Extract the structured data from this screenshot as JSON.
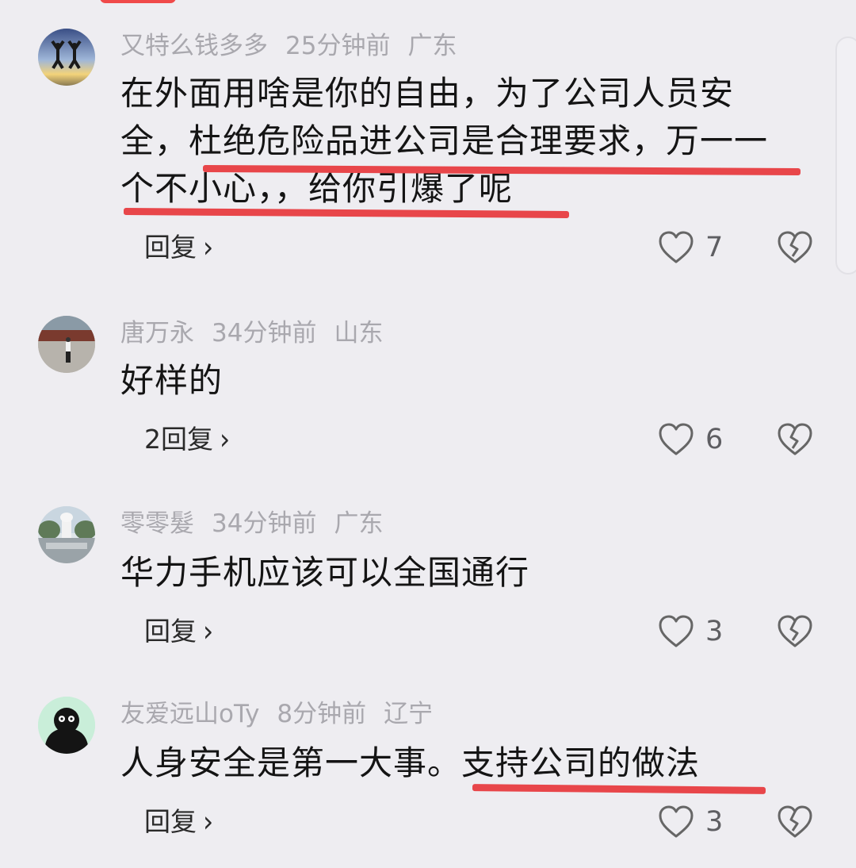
{
  "comments": [
    {
      "user": "又特么钱多多",
      "time": "25分钟前",
      "location": "广东",
      "text_lines": [
        "在外面用啥是你的自由，为了公司人员安",
        "全，杜绝危险品进公司是合理要求，万一一",
        "个不小心，，给你引爆了呢"
      ],
      "reply_label": "回复",
      "likes": "7"
    },
    {
      "user": "唐万永",
      "time": "34分钟前",
      "location": "山东",
      "text_lines": [
        "好样的"
      ],
      "reply_label": "2回复",
      "likes": "6"
    },
    {
      "user": "零零髮",
      "time": "34分钟前",
      "location": "广东",
      "text_lines": [
        "华力手机应该可以全国通行"
      ],
      "reply_label": "回复",
      "likes": "3"
    },
    {
      "user": "友爱远山oTy",
      "time": "8分钟前",
      "location": "辽宁",
      "text_lines": [
        "人身安全是第一大事。支持公司的做法"
      ],
      "reply_label": "回复",
      "likes": "3"
    }
  ],
  "icons": {
    "like": "heart-outline-icon",
    "dislike": "broken-heart-icon",
    "reply_chevron": "chevron-right-icon"
  },
  "colors": {
    "background": "#eeedf1",
    "underline": "#e8464a",
    "meta_text": "#a9a8ae",
    "body_text": "#141414"
  }
}
